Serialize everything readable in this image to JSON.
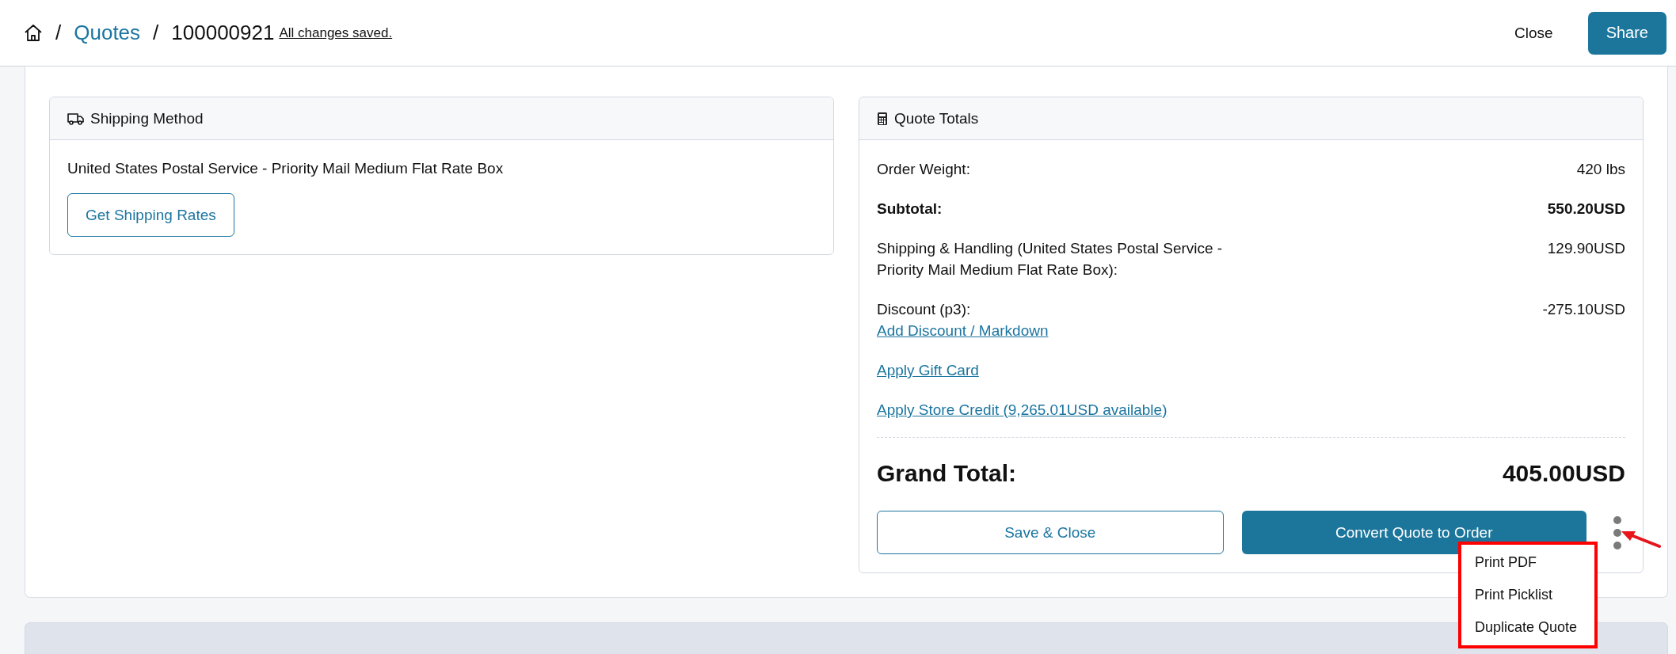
{
  "header": {
    "breadcrumb": [
      {
        "kind": "separator",
        "label": "/"
      },
      {
        "kind": "link",
        "label": "Quotes"
      },
      {
        "kind": "separator",
        "label": "/"
      },
      {
        "kind": "current",
        "label": "100000921"
      }
    ],
    "status": "All changes saved.",
    "close_button": "Close",
    "share_button": "Share"
  },
  "shipping_method": {
    "title": "Shipping Method",
    "method": "United States Postal Service - Priority Mail Medium Flat Rate Box",
    "button": "Get Shipping Rates"
  },
  "quote_totals": {
    "title": "Quote Totals",
    "rows": [
      {
        "kind": "amount",
        "label": "Order Weight:",
        "value": "420 lbs",
        "bold": false
      },
      {
        "kind": "amount",
        "label": "Subtotal:",
        "value": "550.20USD",
        "bold": true
      },
      {
        "kind": "amount",
        "label": "Shipping & Handling (United States Postal Service - Priority Mail Medium Flat Rate Box):",
        "value": "129.90USD",
        "bold": false
      },
      {
        "kind": "amount",
        "label": "Discount (p3):",
        "value": "-275.10USD",
        "bold": false,
        "link": "Add Discount / Markdown"
      },
      {
        "kind": "link",
        "label": "Apply Gift Card"
      },
      {
        "kind": "link",
        "label": "Apply Store Credit (9,265.01USD available)"
      }
    ],
    "grand_total": {
      "label": "Grand Total:",
      "value": "405.00USD"
    },
    "save_button": "Save & Close",
    "convert_button": "Convert Quote to Order",
    "more_menu": {
      "open": true,
      "items": [
        {
          "label": "Print PDF"
        },
        {
          "label": "Print Picklist"
        },
        {
          "label": "Duplicate Quote"
        }
      ]
    }
  }
}
